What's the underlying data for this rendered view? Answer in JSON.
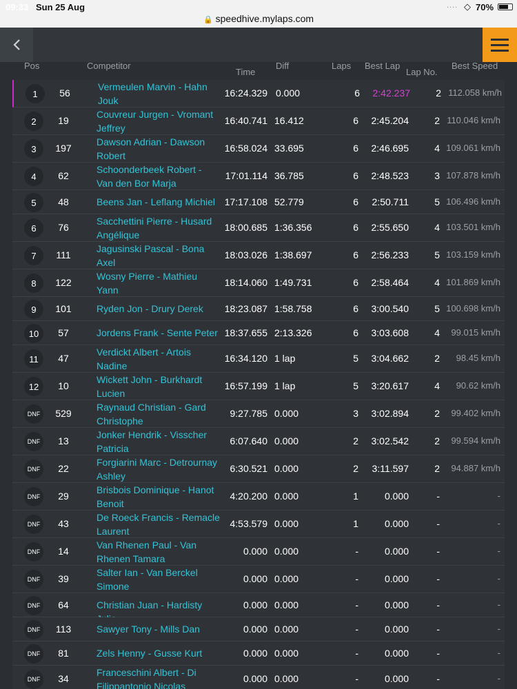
{
  "status": {
    "time": "09:33",
    "date": "Sun 25 Aug",
    "dots": "....",
    "wifi_icon": "wifi-icon",
    "battery": "70%",
    "battery_level": 0.7,
    "url": "speedhive.mylaps.com"
  },
  "nav": {
    "back_icon": "chevron-left-icon",
    "menu_icon": "hamburger-menu-icon"
  },
  "colors": {
    "accent": "#f39a1a",
    "link": "#33c3d6",
    "best_lap_highlight": "#d640d6"
  },
  "headers": {
    "pos": "Pos",
    "competitor": "Competitor",
    "time": "Time",
    "diff": "Diff",
    "laps": "Laps",
    "best_lap": "Best Lap",
    "lap_no": "Lap No.",
    "best_speed": "Best Speed"
  },
  "rows": [
    {
      "pos": "1",
      "num": "56",
      "competitor": "Vermeulen Marvin - Hahn Jouk",
      "time": "16:24.329",
      "diff": "0.000",
      "laps": "6",
      "best": "2:42.237",
      "lapno": "2",
      "speed": "112.058 km/h"
    },
    {
      "pos": "2",
      "num": "19",
      "competitor": "Couvreur Jurgen - Vromant Jeffrey",
      "time": "16:40.741",
      "diff": "16.412",
      "laps": "6",
      "best": "2:45.204",
      "lapno": "2",
      "speed": "110.046 km/h"
    },
    {
      "pos": "3",
      "num": "197",
      "competitor": "Dawson Adrian - Dawson Robert",
      "time": "16:58.024",
      "diff": "33.695",
      "laps": "6",
      "best": "2:46.695",
      "lapno": "4",
      "speed": "109.061 km/h"
    },
    {
      "pos": "4",
      "num": "62",
      "competitor": "Schoonderbeek Robert - Van den Bor Marja",
      "time": "17:01.114",
      "diff": "36.785",
      "laps": "6",
      "best": "2:48.523",
      "lapno": "3",
      "speed": "107.878 km/h"
    },
    {
      "pos": "5",
      "num": "48",
      "competitor": "Beens Jan - Leflang Michiel",
      "time": "17:17.108",
      "diff": "52.779",
      "laps": "6",
      "best": "2:50.711",
      "lapno": "5",
      "speed": "106.496 km/h"
    },
    {
      "pos": "6",
      "num": "76",
      "competitor": "Sacchettini Pierre - Husard Angélique",
      "time": "18:00.685",
      "diff": "1:36.356",
      "laps": "6",
      "best": "2:55.650",
      "lapno": "4",
      "speed": "103.501 km/h"
    },
    {
      "pos": "7",
      "num": "111",
      "competitor": "Jagusinski Pascal - Bona Axel",
      "time": "18:03.026",
      "diff": "1:38.697",
      "laps": "6",
      "best": "2:56.233",
      "lapno": "5",
      "speed": "103.159 km/h"
    },
    {
      "pos": "8",
      "num": "122",
      "competitor": "Wosny Pierre - Mathieu Yann",
      "time": "18:14.060",
      "diff": "1:49.731",
      "laps": "6",
      "best": "2:58.464",
      "lapno": "4",
      "speed": "101.869 km/h"
    },
    {
      "pos": "9",
      "num": "101",
      "competitor": "Ryden Jon - Drury Derek",
      "time": "18:23.087",
      "diff": "1:58.758",
      "laps": "6",
      "best": "3:00.540",
      "lapno": "5",
      "speed": "100.698 km/h"
    },
    {
      "pos": "10",
      "num": "57",
      "competitor": "Jordens Frank - Sente Peter",
      "time": "18:37.655",
      "diff": "2:13.326",
      "laps": "6",
      "best": "3:03.608",
      "lapno": "4",
      "speed": "99.015 km/h"
    },
    {
      "pos": "11",
      "num": "47",
      "competitor": "Verdickt Albert - Artois Nadine",
      "time": "16:34.120",
      "diff": "1 lap",
      "laps": "5",
      "best": "3:04.662",
      "lapno": "2",
      "speed": "98.45 km/h"
    },
    {
      "pos": "12",
      "num": "10",
      "competitor": "Wickett John - Burkhardt Lucien",
      "time": "16:57.199",
      "diff": "1 lap",
      "laps": "5",
      "best": "3:20.617",
      "lapno": "4",
      "speed": "90.62 km/h"
    },
    {
      "pos": "DNF",
      "num": "529",
      "competitor": "Raynaud Christian - Gard Christophe",
      "time": "9:27.785",
      "diff": "0.000",
      "laps": "3",
      "best": "3:02.894",
      "lapno": "2",
      "speed": "99.402 km/h"
    },
    {
      "pos": "DNF",
      "num": "13",
      "competitor": "Jonker Hendrik - Visscher Patricia",
      "time": "6:07.640",
      "diff": "0.000",
      "laps": "2",
      "best": "3:02.542",
      "lapno": "2",
      "speed": "99.594 km/h"
    },
    {
      "pos": "DNF",
      "num": "22",
      "competitor": "Forgiarini Marc - Detrournay Ashley",
      "time": "6:30.521",
      "diff": "0.000",
      "laps": "2",
      "best": "3:11.597",
      "lapno": "2",
      "speed": "94.887 km/h"
    },
    {
      "pos": "DNF",
      "num": "29",
      "competitor": "Brisbois Dominique - Hanot Benoit",
      "time": "4:20.200",
      "diff": "0.000",
      "laps": "1",
      "best": "0.000",
      "lapno": "-",
      "speed": "-"
    },
    {
      "pos": "DNF",
      "num": "43",
      "competitor": "De Roeck Francis - Remacle Laurent",
      "time": "4:53.579",
      "diff": "0.000",
      "laps": "1",
      "best": "0.000",
      "lapno": "-",
      "speed": "-"
    },
    {
      "pos": "DNF",
      "num": "14",
      "competitor": "Van Rhenen Paul - Van Rhenen Tamara",
      "time": "0.000",
      "diff": "0.000",
      "laps": "-",
      "best": "0.000",
      "lapno": "-",
      "speed": "-"
    },
    {
      "pos": "DNF",
      "num": "39",
      "competitor": "Salter Ian - Van Berckel Simone",
      "time": "0.000",
      "diff": "0.000",
      "laps": "-",
      "best": "0.000",
      "lapno": "-",
      "speed": "-"
    },
    {
      "pos": "DNF",
      "num": "64",
      "competitor": "Christian Juan - Hardisty Julie",
      "time": "0.000",
      "diff": "0.000",
      "laps": "-",
      "best": "0.000",
      "lapno": "-",
      "speed": "-"
    },
    {
      "pos": "DNF",
      "num": "113",
      "competitor": "Sawyer Tony - Mills Dan",
      "time": "0.000",
      "diff": "0.000",
      "laps": "-",
      "best": "0.000",
      "lapno": "-",
      "speed": "-"
    },
    {
      "pos": "DNF",
      "num": "81",
      "competitor": "Zels Henny - Gusse Kurt",
      "time": "0.000",
      "diff": "0.000",
      "laps": "-",
      "best": "0.000",
      "lapno": "-",
      "speed": "-"
    },
    {
      "pos": "DNF",
      "num": "34",
      "competitor": "Franceschini Albert - Di Filippantonio Nicolas",
      "time": "0.000",
      "diff": "0.000",
      "laps": "-",
      "best": "0.000",
      "lapno": "-",
      "speed": "-"
    }
  ]
}
